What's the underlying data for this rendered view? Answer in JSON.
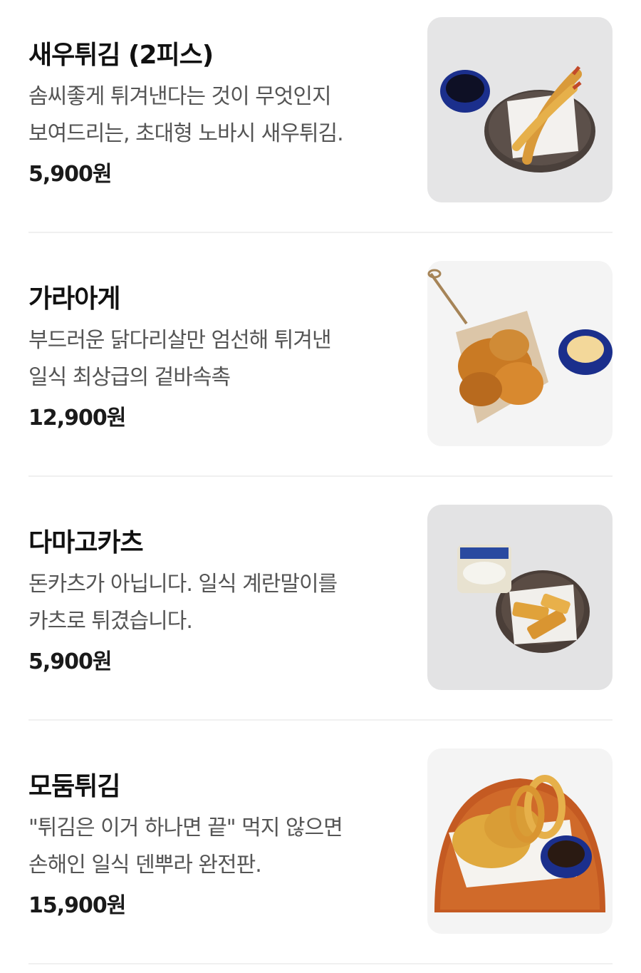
{
  "menu_items": [
    {
      "title": "새우튀김 (2피스)",
      "desc_lines": [
        "솜씨좋게 튀겨낸다는 것이 무엇인지",
        "보여드리는, 초대형 노바시 새우튀김."
      ],
      "price": "5,900원",
      "image_icon": "shrimp-tempura-photo"
    },
    {
      "title": "가라아게",
      "desc_lines": [
        "부드러운 닭다리살만 엄선해 튀겨낸",
        "일식 최상급의 겉바속촉"
      ],
      "price": "12,900원",
      "image_icon": "karaage-photo"
    },
    {
      "title": "다마고카츠",
      "desc_lines": [
        "돈카츠가 아닙니다. 일식 계란말이를",
        "카츠로 튀겼습니다."
      ],
      "price": "5,900원",
      "image_icon": "tamago-katsu-photo"
    },
    {
      "title": "모둠튀김",
      "desc_lines": [
        "\"튀김은 이거 하나면 끝\" 먹지 않으면",
        "손해인 일식 덴뿌라 완전판."
      ],
      "price": "15,900원",
      "image_icon": "assorted-tempura-photo"
    }
  ]
}
